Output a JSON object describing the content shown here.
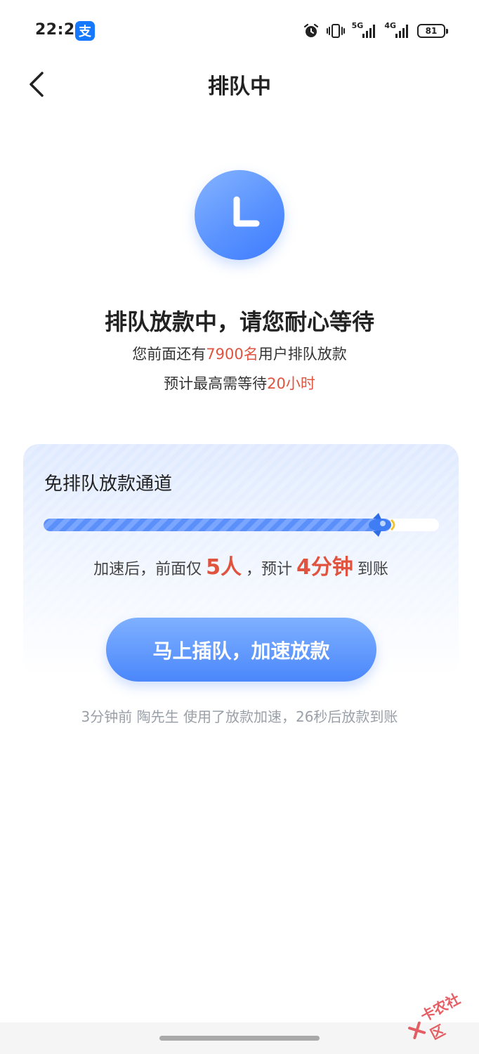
{
  "status_bar": {
    "time": "22:27",
    "app_badge": "支",
    "net_5g": "5G",
    "net_4g": "4G",
    "battery": "81"
  },
  "nav": {
    "title": "排队中"
  },
  "queue": {
    "title": "排队放款中，请您耐心等待",
    "ahead_prefix": "您前面还有",
    "ahead_count": "7900名",
    "ahead_suffix": "用户排队放款",
    "wait_prefix": "预计最高需等待",
    "wait_time": "20小时"
  },
  "fast_lane": {
    "title": "免排队放款通道",
    "progress_fraction": 0.88,
    "speed_prefix": "加速后，前面仅",
    "speed_people": "5人",
    "speed_mid": "，预计",
    "speed_time": "4分钟",
    "speed_suffix": "到账",
    "cta_label": "马上插队，加速放款"
  },
  "ticker": "3分钟前 陶先生 使用了放款加速，26秒后放款到账",
  "watermark": "卡农社区",
  "colors": {
    "accent_blue": "#4a87fb",
    "highlight_red": "#e0533e"
  }
}
